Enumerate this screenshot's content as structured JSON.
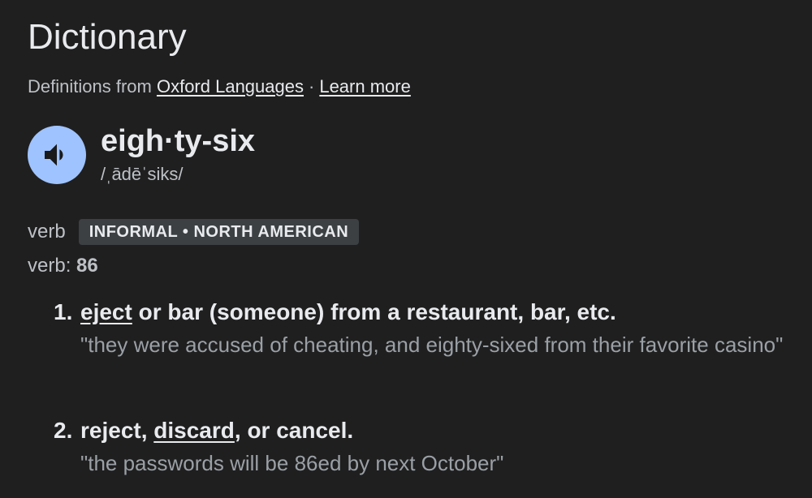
{
  "title": "Dictionary",
  "source": {
    "prefix": "Definitions from",
    "provider_link": "Oxford Languages",
    "separator": "·",
    "learn_more": "Learn more"
  },
  "entry": {
    "headword": "eigh·ty-six",
    "phonetic": "/ˌādēˈsiks/",
    "speaker_icon": "volume-up-icon",
    "part_of_speech": "verb",
    "register_label": "INFORMAL • NORTH AMERICAN",
    "verb_form_prefix": "verb:",
    "verb_form_value": "86",
    "senses": [
      {
        "number": "1.",
        "xref_word": "eject",
        "definition_rest": " or bar (someone) from a restaurant, bar, etc.",
        "example": "\"they were accused of cheating, and eighty-sixed from their favorite casino\""
      },
      {
        "number": "2.",
        "definition_start": "reject, ",
        "xref_word": "discard",
        "definition_rest": ", or cancel.",
        "example": "\"the passwords will be 86ed by next October\""
      }
    ]
  },
  "colors": {
    "background": "#1f1f1f",
    "speaker_bg": "#9fc3ff",
    "chip_bg": "#3c4043"
  }
}
